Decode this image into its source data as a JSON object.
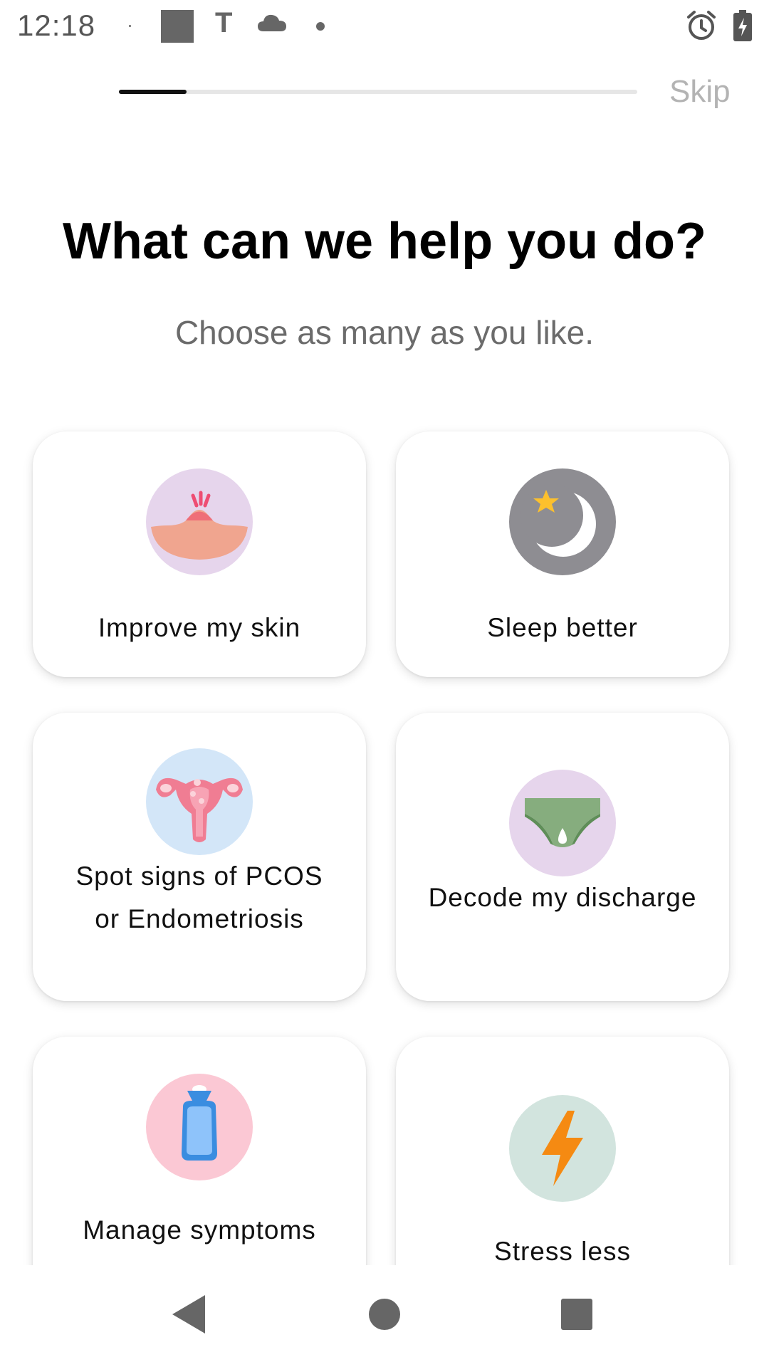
{
  "status_bar": {
    "time": "12:18",
    "icons": [
      "tiny-dot",
      "square-icon",
      "t-icon",
      "cloud-icon",
      "dot-icon",
      "alarm-icon",
      "battery-charging-icon"
    ],
    "t_glyph": "T"
  },
  "header": {
    "progress_fraction": 0.13,
    "skip_label": "Skip"
  },
  "main": {
    "title": "What can we help you do?",
    "subtitle": "Choose as many as you like."
  },
  "options": [
    {
      "label": "Improve my skin",
      "icon": "skin-icon",
      "icon_bg": "#e6d5ec"
    },
    {
      "label": "Sleep better",
      "icon": "moon-star-icon",
      "icon_bg": "#8e8d92"
    },
    {
      "label_line1": "Spot signs of PCOS",
      "label_line2": "or Endometriosis",
      "icon": "uterus-icon",
      "icon_bg": "#d3e6f8"
    },
    {
      "label": "Decode my discharge",
      "icon": "underwear-icon",
      "icon_bg": "#e6d5ec"
    },
    {
      "label": "Manage symptoms",
      "icon": "hot-water-bottle-icon",
      "icon_bg": "#fbc8d4"
    },
    {
      "label": "Stress less",
      "icon": "lightning-icon",
      "icon_bg": "#d2e4de"
    }
  ],
  "nav_bar": {
    "back": "back-triangle-icon",
    "home": "home-circle-icon",
    "recents": "recents-square-icon"
  }
}
